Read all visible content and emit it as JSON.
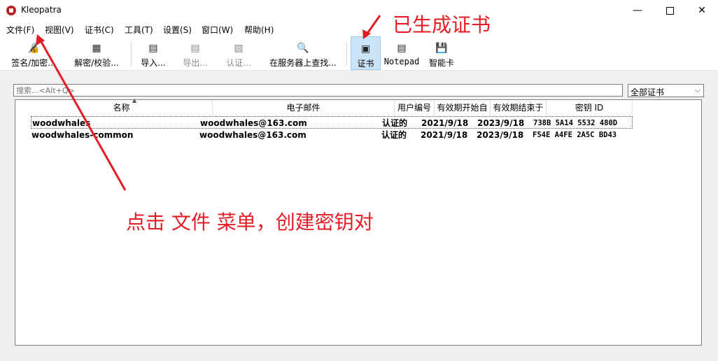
{
  "window": {
    "title": "Kleopatra",
    "minimize_icon": "minimize-icon",
    "maximize_icon": "maximize-icon",
    "close_icon": "close-icon"
  },
  "menu": [
    "文件(F)",
    "视图(V)",
    "证书(C)",
    "工具(T)",
    "设置(S)",
    "窗口(W)",
    "帮助(H)"
  ],
  "toolbar": {
    "sign_encrypt": "签名/加密...",
    "decrypt_verify": "解密/校验...",
    "import": "导入...",
    "export": "导出...",
    "certify": "认证...",
    "lookup_server": "在服务器上查找...",
    "certificates": "证书",
    "notepad": "Notepad",
    "smartcard": "智能卡"
  },
  "search": {
    "placeholder": "搜索...<Alt+Q>"
  },
  "filter": {
    "selected": "全部证书"
  },
  "table": {
    "headers": [
      "名称",
      "电子邮件",
      "用户编号",
      "有效期开始自",
      "有效期结束于",
      "密钥 ID"
    ],
    "rows": [
      [
        "woodwhales",
        "woodwhales@163.com",
        "认证的",
        "2021/9/18",
        "2023/9/18",
        "738B 5A14 5532 480D"
      ],
      [
        "woodwhales-common",
        "woodwhales@163.com",
        "认证的",
        "2021/9/18",
        "2023/9/18",
        "F54E A4FE 2A5C BD43"
      ]
    ]
  },
  "annotations": {
    "top": "已生成证书",
    "middle": "点击 文件 菜单，创建密钥对",
    "color": "#e51c23"
  }
}
